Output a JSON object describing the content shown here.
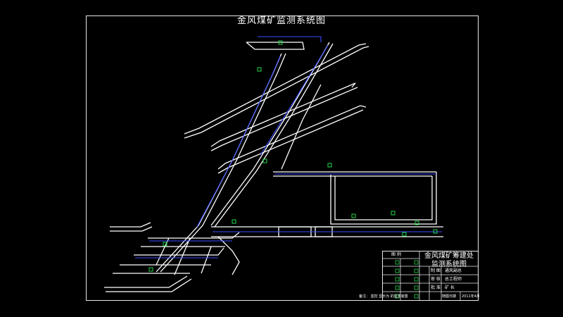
{
  "drawing": {
    "title": "金风煤矿监测系统图"
  },
  "title_block": {
    "org_line1": "金风煤矿筹建处",
    "org_line2": "监测系统图",
    "legend_header": "图    例",
    "roles": [
      {
        "label": "制 图",
        "name": "通风副总"
      },
      {
        "label": "审 核",
        "name": "总工程师"
      },
      {
        "label": "批 准",
        "name": "矿    长"
      }
    ],
    "date_label": "随图日期",
    "date_value": "2011年4月"
  },
  "note": {
    "text": "备注：     监控 显示为 的监测装置"
  },
  "colors": {
    "roadway": "#ffffff",
    "monitor_line": "#3a4cff",
    "sensor_green": "#22d84a",
    "frame": "#e8e8e8",
    "background": "#000000"
  }
}
